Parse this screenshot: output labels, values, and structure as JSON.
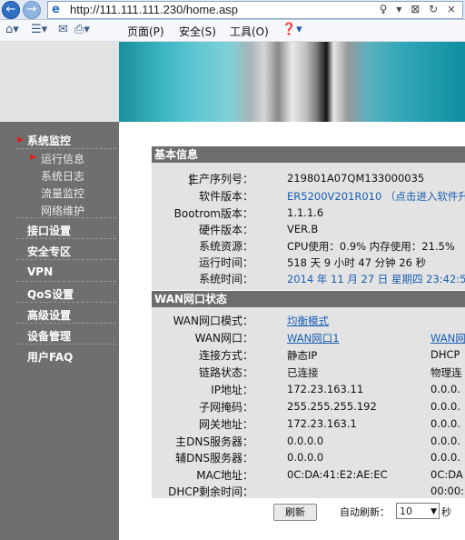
{
  "browser": {
    "url": "http://111.111.111.230/home.asp",
    "url_icons": "♀ ▾ ⊠ ↻ ×",
    "menus": [
      "页面(P)",
      "安全(S)",
      "工具(O)"
    ]
  },
  "sidebar": {
    "groups": [
      {
        "label": "系统监控",
        "active": true
      },
      {
        "label": "接口设置"
      },
      {
        "label": "安全专区"
      },
      {
        "label": "VPN"
      },
      {
        "label": "QoS设置"
      },
      {
        "label": "高级设置"
      },
      {
        "label": "设备管理"
      },
      {
        "label": "用户FAQ"
      }
    ],
    "subitems": [
      {
        "label": "运行信息",
        "active": true
      },
      {
        "label": "系统日志"
      },
      {
        "label": "流量监控"
      },
      {
        "label": "网络维护"
      }
    ]
  },
  "basic_info": {
    "title": "基本信息",
    "rows": [
      {
        "label": "生产序列号：",
        "value": "219801A07QM133000035"
      },
      {
        "label": "软件版本：",
        "value": "ER5200V201R010 （点击进入软件升"
      },
      {
        "label": "Bootrom版本：",
        "value": "1.1.1.6"
      },
      {
        "label": "硬件版本：",
        "value": "VER.B"
      },
      {
        "label": "系统资源：",
        "value": "CPU使用：0.9%    内存使用：21.5%"
      },
      {
        "label": "运行时间：",
        "value": "518 天 9 小时 47 分钟 26 秒"
      },
      {
        "label": "系统时间：",
        "value": "2014 年 11 月 27 日 星期四 23:42:5"
      }
    ]
  },
  "wan": {
    "title": "WAN网口状态",
    "mode_label": "WAN网口模式：",
    "mode_value": "均衡模式",
    "rows": [
      {
        "label": "WAN网口：",
        "v1": "WAN网口1",
        "v2": "WAN网"
      },
      {
        "label": "连接方式：",
        "v1": "静态IP",
        "v2": "DHCP"
      },
      {
        "label": "链路状态：",
        "v1": "已连接",
        "v2": "物理连"
      },
      {
        "label": "IP地址：",
        "v1": "172.23.163.11",
        "v2": "0.0.0."
      },
      {
        "label": "子网掩码：",
        "v1": "255.255.255.192",
        "v2": "0.0.0."
      },
      {
        "label": "网关地址：",
        "v1": "172.23.163.1",
        "v2": "0.0.0."
      },
      {
        "label": "主DNS服务器：",
        "v1": "0.0.0.0",
        "v2": "0.0.0."
      },
      {
        "label": "辅DNS服务器：",
        "v1": "0.0.0.0",
        "v2": "0.0.0."
      },
      {
        "label": "MAC地址：",
        "v1": "0C:DA:41:E2:AE:EC",
        "v2": "0C:DA"
      },
      {
        "label": "DHCP剩余时间：",
        "v1": "",
        "v2": "00:00:"
      }
    ]
  },
  "controls": {
    "refresh_label": "刷新",
    "auto_refresh_label": "自动刷新：",
    "auto_refresh_value": "10",
    "unit": "秒"
  },
  "colors": {
    "link": "#1a5fb4",
    "header_bg": "#6d6d6d",
    "sidebar_bg": "#6f6f6f",
    "active_arrow": "#e02020"
  }
}
